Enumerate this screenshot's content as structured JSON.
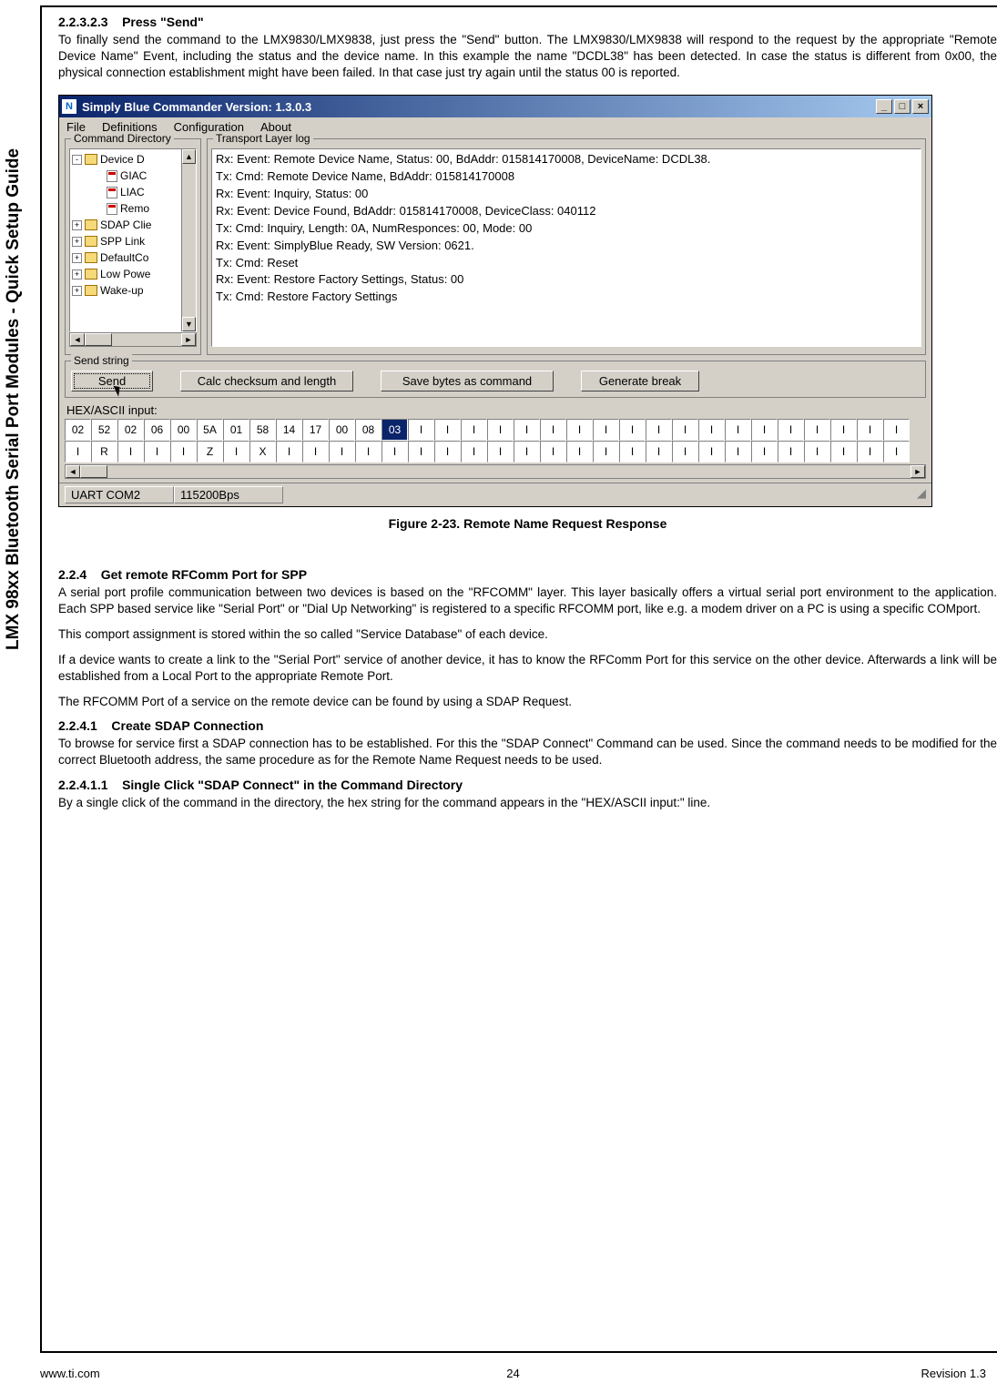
{
  "sidebar_title": "LMX 98xx Bluetooth Serial Port Modules - Quick Setup Guide",
  "sec_223_2_3": {
    "num": "2.2.3.2.3",
    "title": "Press \"Send\""
  },
  "p1": "To finally send the command to the LMX9830/LMX9838, just press the \"Send\" button. The  LMX9830/LMX9838 will respond to the request by the appropriate \"Remote Device Name\" Event, including the status and the device name. In this example the name \"DCDL38\" has been detected. In case the status is different from 0x00, the physical connection establishment might have been failed. In that case  just try again until the status 00 is reported.",
  "win": {
    "title": "Simply Blue Commander    Version: 1.3.0.3",
    "menus": [
      "File",
      "Definitions",
      "Configuration",
      "About"
    ],
    "cmd_dir_label": "Command Directory",
    "tree": [
      {
        "tog": "-",
        "icon": "fold",
        "txt": "Device D",
        "tail": "▲"
      },
      {
        "ind": 1,
        "icon": "doc",
        "txt": "GIAC"
      },
      {
        "ind": 1,
        "icon": "doc",
        "txt": "LIAC"
      },
      {
        "ind": 1,
        "icon": "doc",
        "txt": "Remo"
      },
      {
        "tog": "+",
        "icon": "fold",
        "txt": "SDAP Clie"
      },
      {
        "tog": "+",
        "icon": "fold",
        "txt": "SPP Link"
      },
      {
        "tog": "+",
        "icon": "fold",
        "txt": "DefaultCo"
      },
      {
        "tog": "+",
        "icon": "fold",
        "txt": "Low Powe"
      },
      {
        "tog": "+",
        "icon": "fold",
        "txt": "Wake-up",
        "tail": "▼"
      }
    ],
    "tlog_label": "Transport Layer log",
    "log": [
      "Rx: Event: Remote Device Name, Status: 00, BdAddr: 015814170008, DeviceName: DCDL38.",
      "Tx: Cmd: Remote Device Name, BdAddr: 015814170008",
      "Rx: Event: Inquiry, Status: 00",
      "Rx: Event: Device Found, BdAddr: 015814170008, DeviceClass: 040112",
      "Tx: Cmd: Inquiry, Length: 0A, NumResponces: 00, Mode: 00",
      "Rx: Event: SimplyBlue Ready, SW Version: 0621.",
      "Tx: Cmd: Reset",
      "Rx: Event: Restore Factory Settings, Status: 00",
      "Tx: Cmd: Restore Factory Settings"
    ],
    "send_label": "Send string",
    "buttons": {
      "send": "Send",
      "calc": "Calc checksum and length",
      "save": "Save bytes as command",
      "gen": "Generate break"
    },
    "hexlabel": "HEX/ASCII input:",
    "hexrow1": [
      "02",
      "52",
      "02",
      "06",
      "00",
      "5A",
      "01",
      "58",
      "14",
      "17",
      "00",
      "08",
      "03",
      "I",
      "I",
      "I",
      "I",
      "I",
      "I",
      "I",
      "I",
      "I",
      "I",
      "I",
      "I",
      "I",
      "I",
      "I",
      "I",
      "I",
      "I",
      "I"
    ],
    "hexrow1_sel": 12,
    "hexrow2": [
      "I",
      "R",
      "I",
      "I",
      "I",
      "Z",
      "I",
      "X",
      "I",
      "I",
      "I",
      "I",
      "I",
      "I",
      "I",
      "I",
      "I",
      "I",
      "I",
      "I",
      "I",
      "I",
      "I",
      "I",
      "I",
      "I",
      "I",
      "I",
      "I",
      "I",
      "I",
      "I"
    ],
    "status": {
      "port": "UART COM2",
      "baud": "115200Bps"
    }
  },
  "figcap": "Figure 2-23.  Remote Name Request Response",
  "sec_2_2_4": {
    "num": "2.2.4",
    "title": "Get remote RFComm Port for SPP"
  },
  "p2": "A serial port profile communication between two devices is based on the \"RFCOMM\" layer. This layer basically offers a virtual serial port environment to the application. Each SPP based service like \"Serial Port\" or \"Dial Up Networking\" is registered to a specific RFCOMM port, like e.g. a modem driver on a PC is using a specific COMport.",
  "p3": "This comport assignment is stored within the so called \"Service Database\" of each device.",
  "p4": "If a device wants to create a link to the \"Serial Port\" service of another device, it has to know the RFComm Port for this service on the other device. Afterwards a link will be established from a Local Port to the appropriate Remote Port.",
  "p5": "The RFCOMM Port of a service on the remote device can be found by using a SDAP Request.",
  "sec_2_2_4_1": {
    "num": "2.2.4.1",
    "title": "Create SDAP Connection"
  },
  "p6": "To browse for service first a SDAP connection has to be established. For this the \"SDAP Connect\" Command can be used. Since the command needs to be modified for the correct Bluetooth address, the same procedure as for the Remote Name Request needs to be used.",
  "sec_2_2_4_1_1": {
    "num": "2.2.4.1.1",
    "title": "Single Click \"SDAP Connect\" in the Command Directory"
  },
  "p7": "By a single click of the command in the directory, the hex string for the command appears in the \"HEX/ASCII input:\" line.",
  "footer": {
    "left": "www.ti.com",
    "mid": "24",
    "right": "Revision 1.3"
  }
}
